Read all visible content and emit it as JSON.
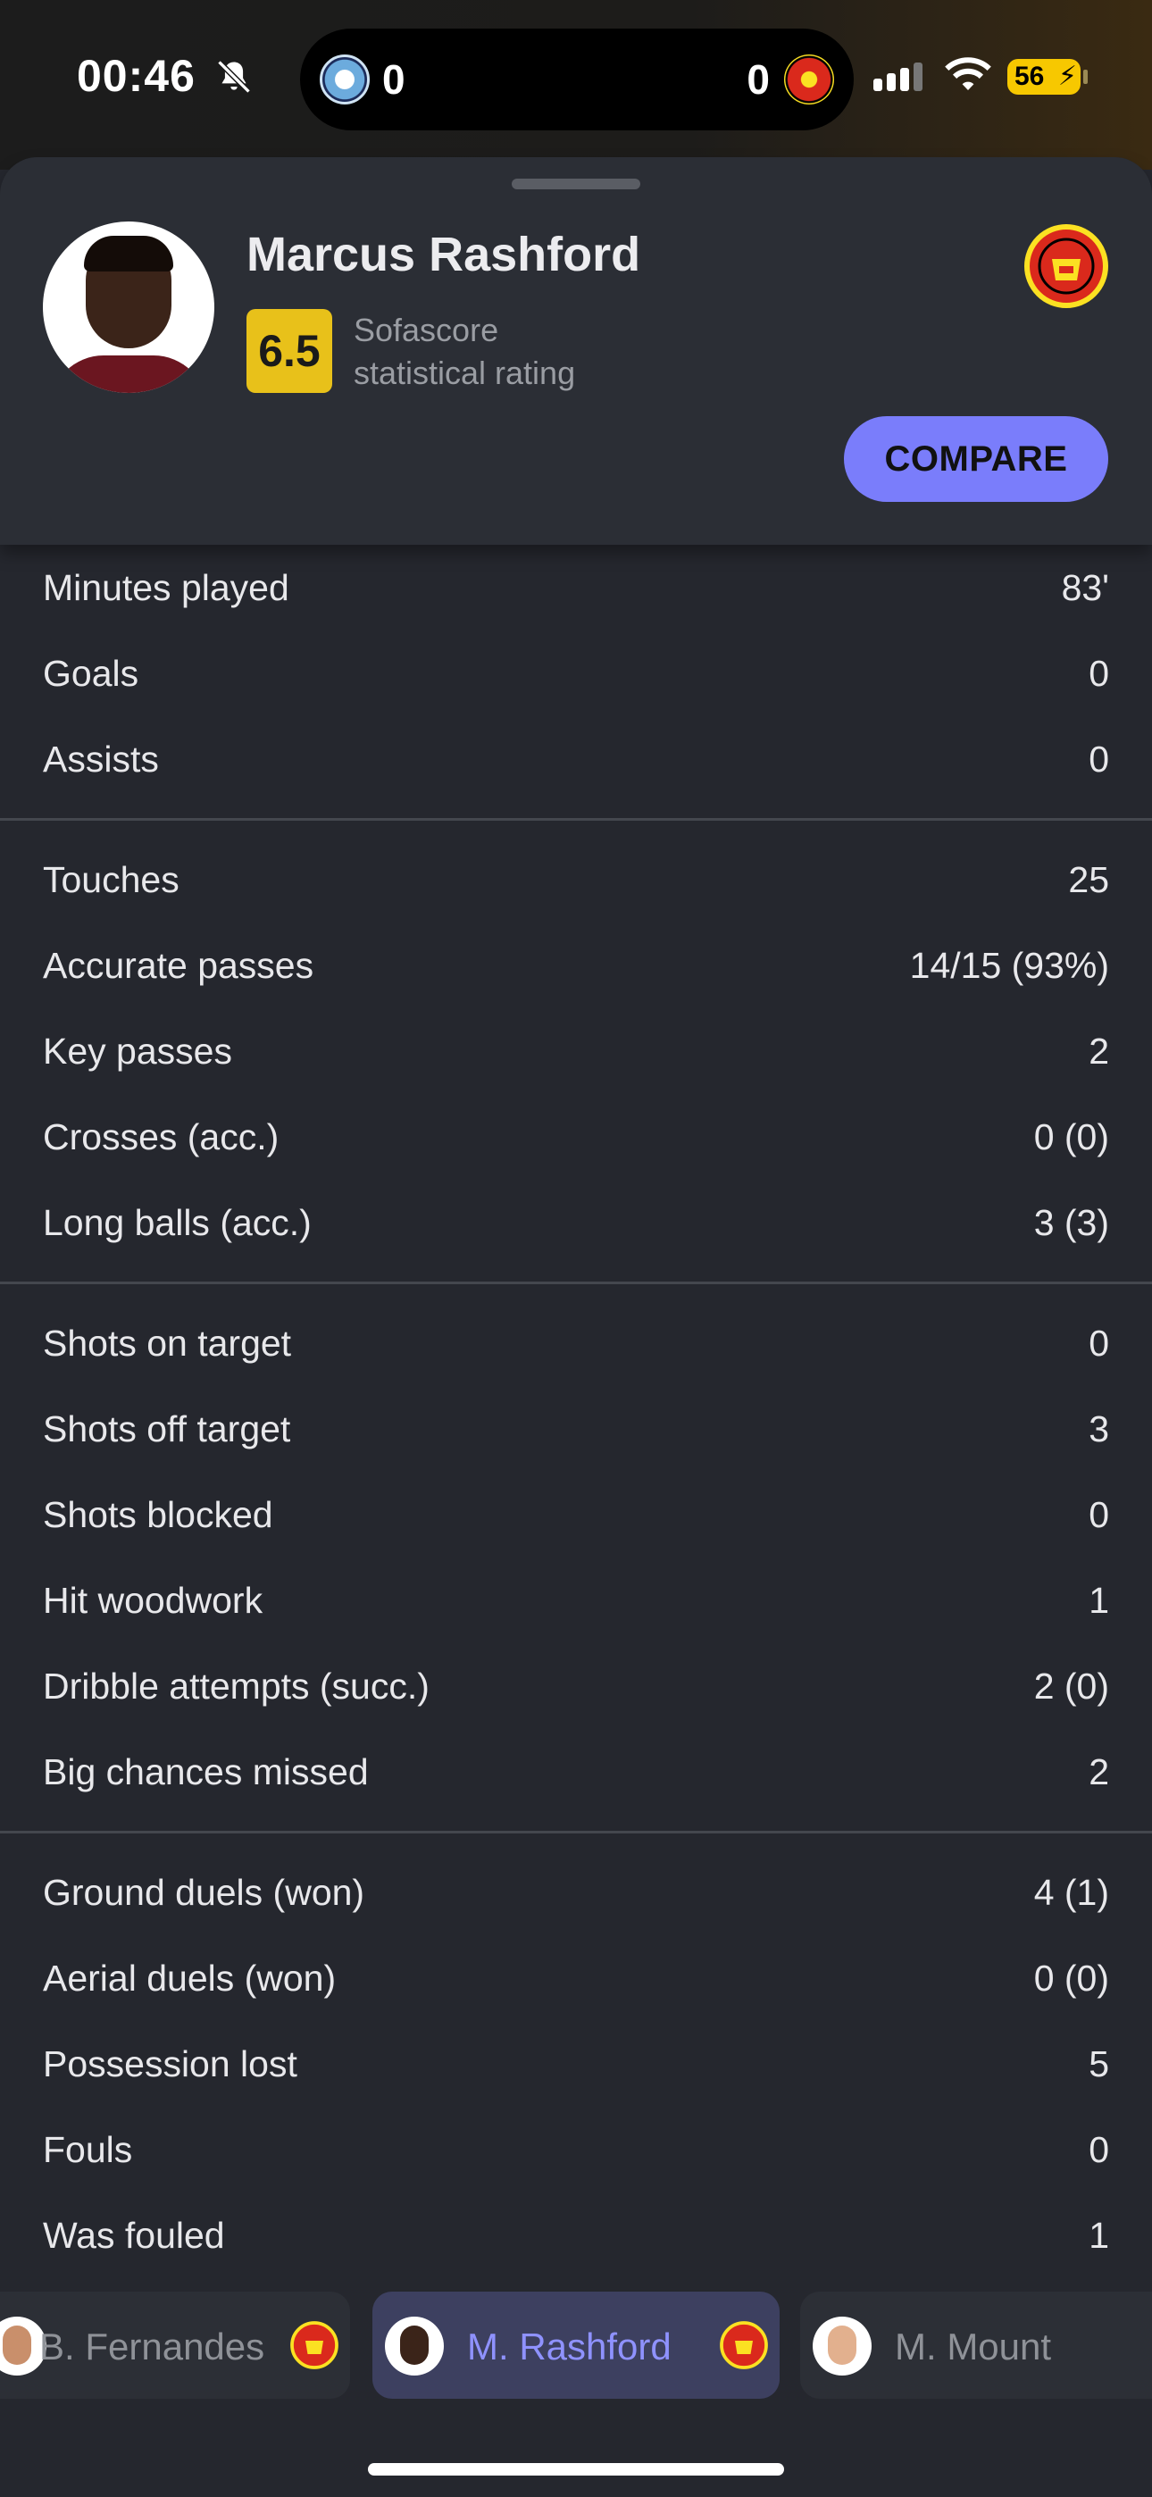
{
  "status_bar": {
    "time": "00:46",
    "home_score": "0",
    "away_score": "0",
    "battery": "56"
  },
  "player": {
    "name": "Marcus Rashford",
    "rating": "6.5",
    "rating_label": "Sofascore statistical rating",
    "compare_label": "COMPARE"
  },
  "stat_groups": [
    [
      {
        "label": "Minutes played",
        "value": "83'"
      },
      {
        "label": "Goals",
        "value": "0"
      },
      {
        "label": "Assists",
        "value": "0"
      }
    ],
    [
      {
        "label": "Touches",
        "value": "25"
      },
      {
        "label": "Accurate passes",
        "value": "14/15 (93%)"
      },
      {
        "label": "Key passes",
        "value": "2"
      },
      {
        "label": "Crosses (acc.)",
        "value": "0 (0)"
      },
      {
        "label": "Long balls (acc.)",
        "value": "3 (3)"
      }
    ],
    [
      {
        "label": "Shots on target",
        "value": "0"
      },
      {
        "label": "Shots off target",
        "value": "3"
      },
      {
        "label": "Shots blocked",
        "value": "0"
      },
      {
        "label": "Hit woodwork",
        "value": "1"
      },
      {
        "label": "Dribble attempts (succ.)",
        "value": "2 (0)"
      },
      {
        "label": "Big chances missed",
        "value": "2"
      }
    ],
    [
      {
        "label": "Ground duels (won)",
        "value": "4 (1)"
      },
      {
        "label": "Aerial duels (won)",
        "value": "0 (0)"
      },
      {
        "label": "Possession lost",
        "value": "5"
      },
      {
        "label": "Fouls",
        "value": "0"
      },
      {
        "label": "Was fouled",
        "value": "1"
      }
    ]
  ],
  "player_switcher": [
    {
      "name": "B. Fernandes",
      "active": false
    },
    {
      "name": "M. Rashford",
      "active": true
    },
    {
      "name": "M. Mount",
      "active": false
    }
  ],
  "colors": {
    "accent": "#7a7dfb",
    "rating_badge": "#e8c11a",
    "background": "#25272e"
  }
}
